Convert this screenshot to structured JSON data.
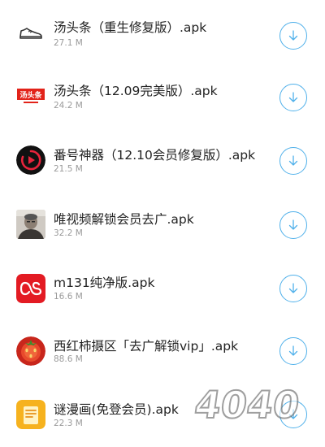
{
  "apps": [
    {
      "name": "汤头条（重生修复版）.apk",
      "size": "27.1 M",
      "icon": "sneaker-icon"
    },
    {
      "name": "汤头条（12.09完美版）.apk",
      "size": "24.2 M",
      "icon": "tangtoutiao-logo-icon",
      "icon_text": "汤头条"
    },
    {
      "name": "番号神器（12.10会员修复版）.apk",
      "size": "21.5 M",
      "icon": "play-circle-icon"
    },
    {
      "name": "唯视频解锁会员去广.apk",
      "size": "32.2 M",
      "icon": "avatar-photo-icon"
    },
    {
      "name": "m131纯净版.apk",
      "size": "16.6 M",
      "icon": "lastfm-logo-icon"
    },
    {
      "name": "西红柿摄区「去广解锁vip」.apk",
      "size": "88.6 M",
      "icon": "tomato-icon"
    },
    {
      "name": "谜漫画(免登会员).apk",
      "size": "22.3 M",
      "icon": "comic-book-icon"
    }
  ],
  "download_icon": "download-arrow-icon",
  "watermark_text": "4040",
  "colors": {
    "accent": "#4fb0ea",
    "text": "#222222",
    "muted": "#9a9a9a"
  }
}
